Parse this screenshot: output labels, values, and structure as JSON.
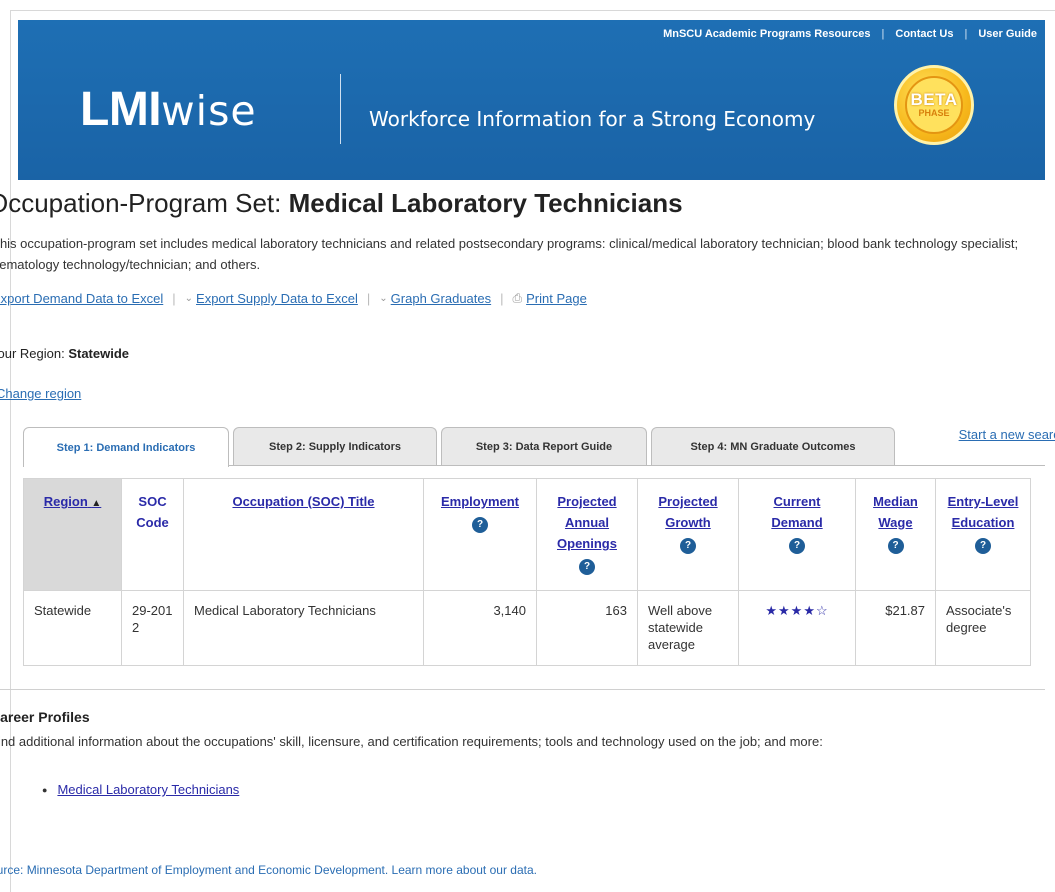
{
  "header": {
    "top_links": [
      "MnSCU Academic Programs Resources",
      "Contact Us",
      "User Guide"
    ],
    "logo_bold": "LMI",
    "logo_light": "wise",
    "tagline": "Workforce Information for a Strong Economy",
    "badge_top": "BETA",
    "badge_bottom": "PHASE"
  },
  "page": {
    "title_prefix": "Occupation-Program Set: ",
    "title_name": "Medical Laboratory Technicians",
    "description": "This occupation-program set includes medical laboratory technicians and related postsecondary programs: clinical/medical laboratory technician; blood bank technology specialist; hematology technology/technician; and others.",
    "actions": [
      "Export Demand Data to Excel",
      "Export Supply Data to Excel",
      "Graph Graduates",
      "Print Page"
    ],
    "region_label": "Your Region: ",
    "region_value": "Statewide",
    "change_region": "Change region"
  },
  "tabs": {
    "items": [
      "Step 1: Demand Indicators",
      "Step 2: Supply Indicators",
      "Step 3: Data Report Guide",
      "Step 4: MN Graduate Outcomes"
    ],
    "active": 0,
    "new_search": "Start a new search"
  },
  "table": {
    "headers": [
      "Region",
      "SOC Code",
      "Occupation (SOC) Title",
      "Employment",
      "Projected Annual Openings",
      "Projected Growth",
      "Current Demand",
      "Median Wage",
      "Entry-Level Education"
    ],
    "sort_indicator": "▲",
    "row": {
      "region": "Statewide",
      "soc_code": "29-2012",
      "title": "Medical Laboratory Technicians",
      "employment": "3,140",
      "openings": "163",
      "growth": "Well above statewide average",
      "demand_stars": "★★★★☆",
      "demand_rating": 4,
      "median_wage": "$21.87",
      "education": "Associate's degree"
    }
  },
  "career": {
    "heading": "Career Profiles",
    "description": "Find additional information about the occupations' skill, licensure, and certification requirements; tools and technology used on the job; and more:",
    "links": [
      "Medical Laboratory Technicians"
    ]
  },
  "footer": {
    "source": "Source: Minnesota Department of Employment and Economic Development. Learn more about our data."
  },
  "colors": {
    "banner": "#1e6fb4",
    "link": "#2a6db3",
    "help_icon": "#1f5e98",
    "badge": "#f7b91c"
  }
}
